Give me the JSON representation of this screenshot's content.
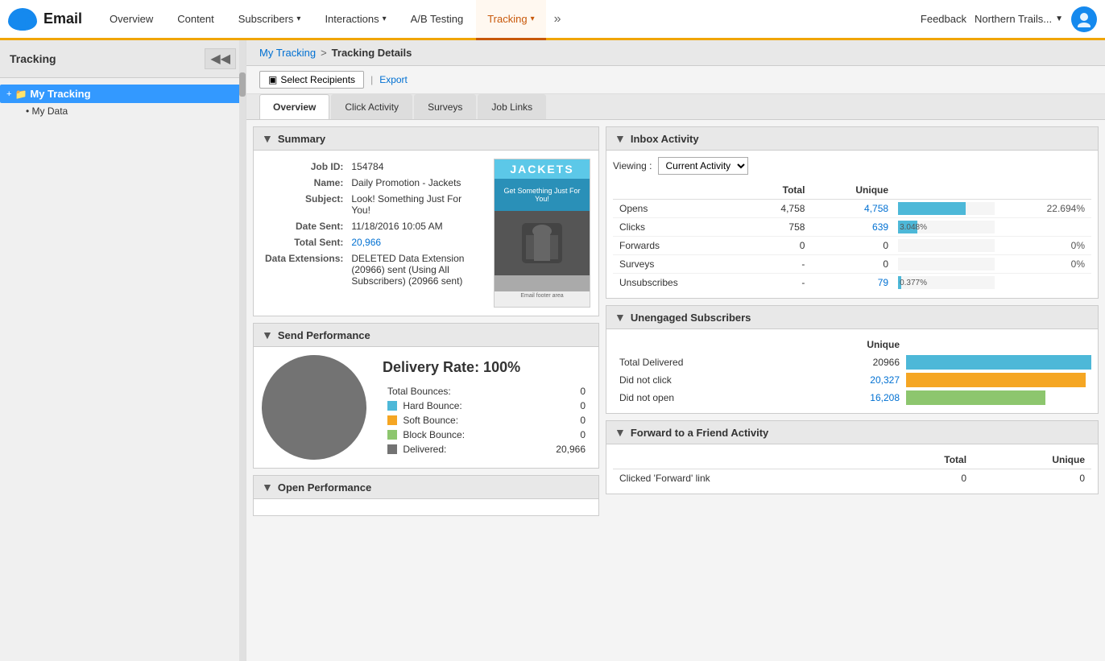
{
  "app": {
    "name": "Email",
    "logo_icon": "cloud"
  },
  "nav": {
    "items": [
      {
        "label": "Overview",
        "active": false,
        "has_arrow": false
      },
      {
        "label": "Content",
        "active": false,
        "has_arrow": false
      },
      {
        "label": "Subscribers",
        "active": false,
        "has_arrow": true
      },
      {
        "label": "Interactions",
        "active": false,
        "has_arrow": true
      },
      {
        "label": "A/B Testing",
        "active": false,
        "has_arrow": false
      },
      {
        "label": "Tracking",
        "active": true,
        "has_arrow": true
      }
    ],
    "more_icon": "»",
    "feedback": "Feedback",
    "account": "Northern Trails...",
    "account_arrow": "▼"
  },
  "sidebar": {
    "title": "Tracking",
    "collapse_label": "◀◀",
    "tree": [
      {
        "label": "My Tracking",
        "selected": true,
        "icon": "folder"
      }
    ],
    "subitems": [
      {
        "label": "My Data"
      }
    ]
  },
  "breadcrumb": {
    "parent": "My Tracking",
    "separator": ">",
    "current": "Tracking Details"
  },
  "toolbar": {
    "select_recipients": "Select Recipients",
    "export": "Export",
    "select_icon": "▣"
  },
  "tabs": [
    {
      "label": "Overview",
      "active": true
    },
    {
      "label": "Click Activity",
      "active": false
    },
    {
      "label": "Surveys",
      "active": false
    },
    {
      "label": "Job Links",
      "active": false
    }
  ],
  "summary": {
    "section_title": "Summary",
    "fields": [
      {
        "key": "Job ID:",
        "value": "154784",
        "link": false
      },
      {
        "key": "Name:",
        "value": "Daily Promotion - Jackets",
        "link": false
      },
      {
        "key": "Subject:",
        "value": "Look! Something Just For You!",
        "link": false
      },
      {
        "key": "Date Sent:",
        "value": "11/18/2016 10:05 AM",
        "link": false
      },
      {
        "key": "Total Sent:",
        "value": "20,966",
        "link": true
      },
      {
        "key": "Data Extensions:",
        "value": "DELETED Data Extension (20966) sent (Using All Subscribers) (20966 sent)",
        "link": false
      }
    ],
    "image_text": "JACKETS"
  },
  "inbox_activity": {
    "section_title": "Inbox Activity",
    "viewing_label": "Viewing :",
    "viewing_option": "Current Activity",
    "columns": [
      "",
      "Total",
      "Unique",
      "",
      ""
    ],
    "rows": [
      {
        "label": "Opens",
        "total": "4,758",
        "unique": "4,758",
        "unique_link": true,
        "pct": "22.694%",
        "bar_pct": 70,
        "bar_color": "blue"
      },
      {
        "label": "Clicks",
        "total": "758",
        "unique": "639",
        "unique_link": true,
        "pct": "3.048%",
        "bar_pct": 20,
        "bar_color": "blue"
      },
      {
        "label": "Forwards",
        "total": "0",
        "unique": "0",
        "unique_link": false,
        "pct": "0%",
        "bar_pct": 0,
        "bar_color": "blue"
      },
      {
        "label": "Surveys",
        "total": "-",
        "unique": "0",
        "unique_link": false,
        "pct": "0%",
        "bar_pct": 0,
        "bar_color": "blue"
      },
      {
        "label": "Unsubscribes",
        "total": "-",
        "unique": "79",
        "unique_link": true,
        "pct": "0.377%",
        "bar_pct": 3,
        "bar_color": "blue"
      }
    ]
  },
  "send_performance": {
    "section_title": "Send Performance",
    "delivery_rate": "Delivery Rate: 100%",
    "rows": [
      {
        "label": "Total Bounces:",
        "value": "0",
        "swatch": null
      },
      {
        "label": "Hard Bounce:",
        "value": "0",
        "swatch": "blue"
      },
      {
        "label": "Soft Bounce:",
        "value": "0",
        "swatch": "orange"
      },
      {
        "label": "Block Bounce:",
        "value": "0",
        "swatch": "green"
      },
      {
        "label": "Delivered:",
        "value": "20,966",
        "swatch": "gray"
      }
    ]
  },
  "unengaged": {
    "section_title": "Unengaged Subscribers",
    "columns": [
      "",
      "Unique",
      ""
    ],
    "rows": [
      {
        "label": "Total Delivered",
        "value": "20966",
        "link": false,
        "bar_pct": 100,
        "bar_color": "#4db8d8"
      },
      {
        "label": "Did not click",
        "value": "20,327",
        "link": true,
        "bar_pct": 97,
        "bar_color": "#f5a623"
      },
      {
        "label": "Did not open",
        "value": "16,208",
        "link": true,
        "bar_pct": 75,
        "bar_color": "#8dc66e"
      }
    ]
  },
  "forward_activity": {
    "section_title": "Forward to a Friend Activity",
    "columns": [
      "",
      "Total",
      "Unique"
    ],
    "rows": [
      {
        "label": "Clicked 'Forward' link",
        "total": "0",
        "unique": "0"
      }
    ]
  },
  "open_performance": {
    "section_title": "Open Performance"
  }
}
